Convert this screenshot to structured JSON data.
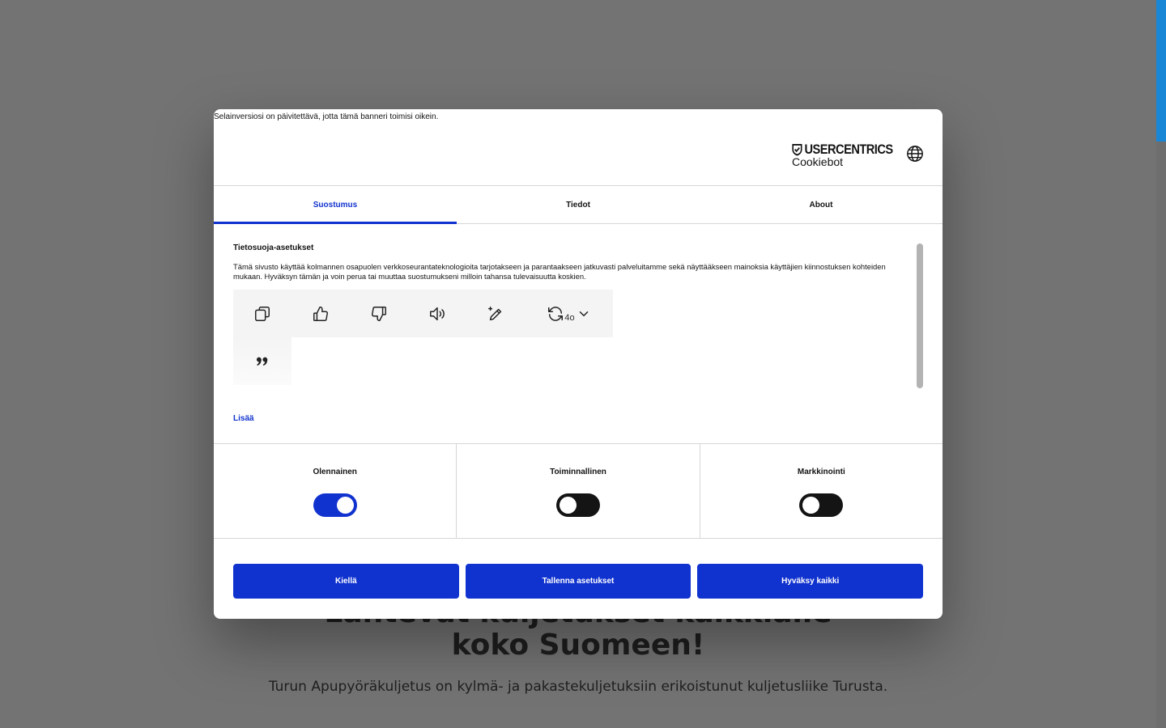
{
  "background": {
    "heading_line1": "Lähtevät kuljetukset kaikkialle",
    "heading_line2": "koko Suomeen!",
    "subtitle": "Turun Apupyöräkuljetus on kylmä- ja pakastekuljetuksiin erikoistunut kuljetusliike Turusta."
  },
  "dialog": {
    "browser_warning": "Selainversiosi on päivitettävä, jotta tämä banneri toimisi oikein.",
    "brand": {
      "line1": "USERCENTRICS",
      "line2": "Cookiebot"
    },
    "tabs": [
      {
        "label": "Suostumus",
        "active": true
      },
      {
        "label": "Tiedot",
        "active": false
      },
      {
        "label": "About",
        "active": false
      }
    ],
    "content": {
      "title": "Tietosuoja-asetukset",
      "text": "Tämä sivusto käyttää kolmannen osapuolen verkkoseurantateknologioita tarjotakseen ja parantaakseen jatkuvasti palveluitamme sekä näyttääkseen mainoksia käyttäjien kiinnostuksen kohteiden mukaan. Hyväksyn tämän ja voin perua tai muuttaa suostumukseni milloin tahansa tulevaisuutta koskien.",
      "regenerate_model": "4o",
      "more_link": "Lisää"
    },
    "categories": [
      {
        "label": "Olennainen",
        "enabled": true
      },
      {
        "label": "Toiminnallinen",
        "enabled": false
      },
      {
        "label": "Markkinointi",
        "enabled": false
      }
    ],
    "buttons": {
      "deny": "Kiellä",
      "save": "Tallenna asetukset",
      "accept_all": "Hyväksy kaikki"
    }
  },
  "colors": {
    "accent": "#1032cf",
    "overlay": "#737373",
    "scrollbar_thumb": "#1a86d6"
  }
}
